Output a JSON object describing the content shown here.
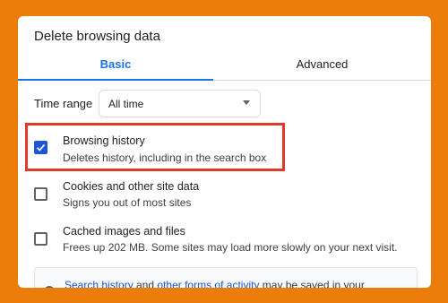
{
  "dialog": {
    "title": "Delete browsing data"
  },
  "tabs": [
    {
      "label": "Basic",
      "active": true
    },
    {
      "label": "Advanced",
      "active": false
    }
  ],
  "time_range": {
    "label": "Time range",
    "value": "All time"
  },
  "items": [
    {
      "title": "Browsing history",
      "subtitle": "Deletes history, including in the search box",
      "checked": true
    },
    {
      "title": "Cookies and other site data",
      "subtitle": "Signs you out of most sites",
      "checked": false
    },
    {
      "title": "Cached images and files",
      "subtitle": "Frees up 202 MB. Some sites may load more slowly on your next visit.",
      "checked": false
    }
  ],
  "info": {
    "link1": "Search history",
    "text1": " and ",
    "link2": "other forms of activity",
    "text2": " may be saved in your"
  },
  "colors": {
    "page_background": "#ED7D0B",
    "accent": "#1a73e8",
    "highlight_border": "#e03a2c"
  },
  "icons": {
    "checkbox_checked": "check-icon",
    "dropdown": "chevron-down-icon",
    "info": "info-icon"
  }
}
